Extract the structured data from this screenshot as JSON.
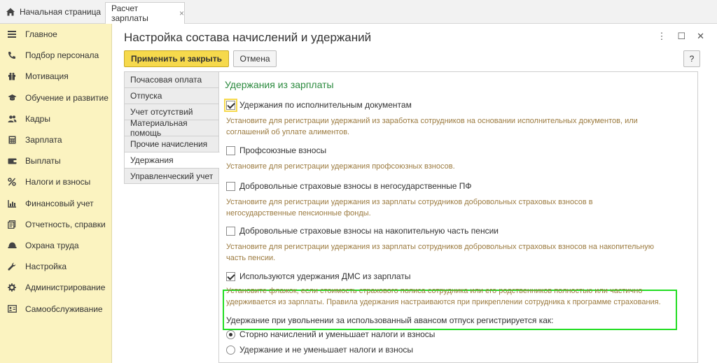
{
  "topbar": {
    "home_label": "Начальная страница",
    "doc_tab_label": "Расчет зарплаты",
    "doc_tab_close": "×"
  },
  "sidebar": {
    "items": [
      {
        "label": "Главное",
        "icon": "menu-lines-icon"
      },
      {
        "label": "Подбор персонала",
        "icon": "phone-icon"
      },
      {
        "label": "Мотивация",
        "icon": "gift-icon"
      },
      {
        "label": "Обучение и развитие",
        "icon": "graduation-cap-icon"
      },
      {
        "label": "Кадры",
        "icon": "people-icon"
      },
      {
        "label": "Зарплата",
        "icon": "calculator-icon"
      },
      {
        "label": "Выплаты",
        "icon": "wallet-icon"
      },
      {
        "label": "Налоги и взносы",
        "icon": "percent-icon"
      },
      {
        "label": "Финансовый учет",
        "icon": "ledger-icon"
      },
      {
        "label": "Отчетность, справки",
        "icon": "reports-icon"
      },
      {
        "label": "Охрана труда",
        "icon": "helmet-icon"
      },
      {
        "label": "Настройка",
        "icon": "wrench-icon"
      },
      {
        "label": "Администрирование",
        "icon": "gear-icon"
      },
      {
        "label": "Самообслуживание",
        "icon": "id-card-icon"
      }
    ]
  },
  "window": {
    "title": "Настройка состава начислений и удержаний",
    "more": "⋮",
    "maximize": "☐",
    "close": "✕",
    "apply_label": "Применить и закрыть",
    "cancel_label": "Отмена",
    "help_label": "?"
  },
  "tabs": [
    {
      "label": "Почасовая оплата"
    },
    {
      "label": "Отпуска"
    },
    {
      "label": "Учет отсутствий"
    },
    {
      "label": "Материальная помощь"
    },
    {
      "label": "Прочие начисления"
    },
    {
      "label": "Удержания",
      "active": true
    },
    {
      "label": "Управленческий учет"
    }
  ],
  "content": {
    "section_title": "Удержания из зарплаты",
    "options": [
      {
        "label": "Удержания по исполнительным документам",
        "checked": true,
        "desc": "Установите для регистрации удержаний из заработка сотрудников на основании исполнительных документов, или соглашений об уплате алиментов."
      },
      {
        "label": "Профсоюзные взносы",
        "checked": false,
        "desc": "Установите для регистрации удержания профсоюзных взносов."
      },
      {
        "label": "Добровольные страховые взносы в негосударственные ПФ",
        "checked": false,
        "desc": "Установите для регистрации удержания из зарплаты сотрудников добровольных страховых взносов в негосударственные пенсионные фонды."
      },
      {
        "label": "Добровольные страховые взносы на накопительную часть пенсии",
        "checked": false,
        "desc": "Установите для регистрации удержания из зарплаты сотрудников добровольных страховых взносов на накопительную часть пенсии."
      },
      {
        "label": "Используются удержания ДМС из зарплаты",
        "checked": true,
        "desc": "Установите флажок, если стоимость страхового полиса сотрудника или его родственников полностью или частично удерживается из зарплаты. Правила удержания настраиваются при прикреплении сотрудника к программе страхования."
      }
    ],
    "radio_question": "Удержание при увольнении за использованный авансом отпуск регистрируется как:",
    "radios": [
      {
        "label": "Сторно начислений и уменьшает налоги и взносы",
        "selected": true
      },
      {
        "label": "Удержание и не уменьшает налоги и взносы",
        "selected": false
      }
    ]
  },
  "colors": {
    "sidebar_bg": "#fbf3c0",
    "primary_button": "#f6d94c",
    "section_title": "#2b8a3e",
    "description_text": "#9b7a3f",
    "highlight_border": "#22dd22"
  }
}
